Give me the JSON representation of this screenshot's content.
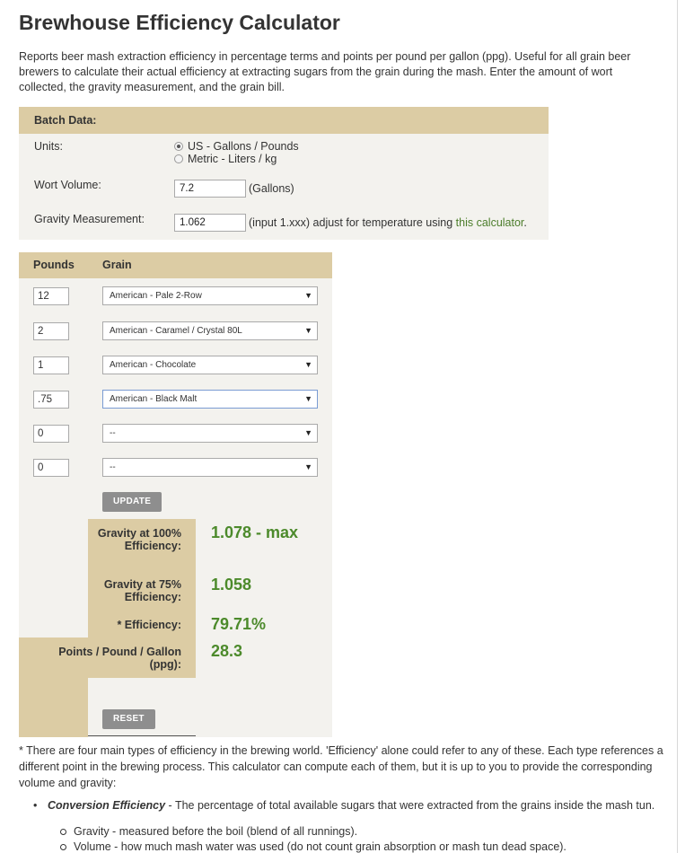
{
  "title": "Brewhouse Efficiency Calculator",
  "intro": "Reports beer mash extraction efficiency in percentage terms and points per pound per gallon (ppg). Useful for all grain beer brewers to calculate their actual efficiency at extracting sugars from the grain during the mash. Enter the amount of wort collected, the gravity measurement, and the grain bill.",
  "batch": {
    "header": "Batch Data:",
    "units_label": "Units:",
    "units_options": [
      "US - Gallons / Pounds",
      "Metric - Liters / kg"
    ],
    "units_selected": 0,
    "wort_label": "Wort Volume:",
    "wort_value": "7.2",
    "wort_unit": "(Gallons)",
    "gravity_label": "Gravity Measurement:",
    "gravity_value": "1.062",
    "gravity_note": "(input 1.xxx) adjust for temperature using ",
    "gravity_link": "this calculator",
    "gravity_note_end": "."
  },
  "grain": {
    "col_pounds": "Pounds",
    "col_grain": "Grain",
    "rows": [
      {
        "pounds": "12",
        "grain": "American - Pale 2-Row"
      },
      {
        "pounds": "2",
        "grain": "American - Caramel / Crystal 80L"
      },
      {
        "pounds": "1",
        "grain": "American - Chocolate"
      },
      {
        "pounds": ".75",
        "grain": "American - Black Malt"
      },
      {
        "pounds": "0",
        "grain": "--"
      },
      {
        "pounds": "0",
        "grain": "--"
      }
    ],
    "update_label": "UPDATE",
    "reset_label": "RESET"
  },
  "results": {
    "max_label": "Gravity at 100% Efficiency:",
    "max_value": "1.078 - max",
    "g75_label": "Gravity at 75% Efficiency:",
    "g75_value": "1.058",
    "eff_label": "* Efficiency:",
    "eff_value": "79.71%",
    "ppg_label": "Points / Pound / Gallon (ppg):",
    "ppg_value": "28.3"
  },
  "footnote": "* There are four main types of efficiency in the brewing world. 'Efficiency' alone could refer to any of these. Each type references a different point in the brewing process. This calculator can compute each of them, but it is up to you to provide the corresponding volume and gravity:",
  "list": {
    "item1_title": "Conversion Efficiency",
    "item1_text": " - The percentage of total available sugars that were extracted from the grains inside the mash tun.",
    "sub1": "Gravity - measured before the boil (blend of all runnings).",
    "sub2": "Volume - how much mash water was used (do not count grain absorption or mash tun dead space)."
  },
  "colors": {
    "accent_tan": "#dccca4",
    "panel_bg": "#f3f2ee",
    "result_green": "#4c8a2b",
    "link_green": "#4c7d2b"
  }
}
